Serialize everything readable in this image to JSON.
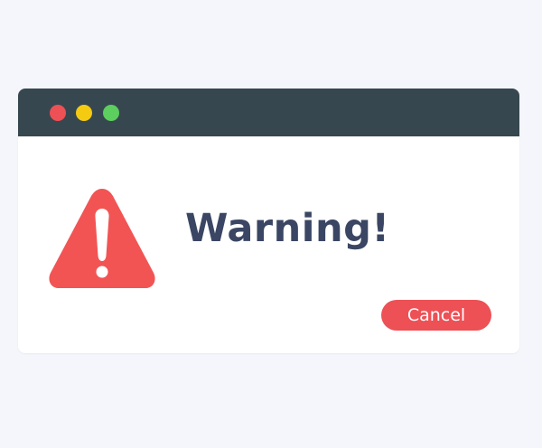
{
  "dialog": {
    "title": "Warning!",
    "cancel_label": "Cancel",
    "icon": "warning-triangle-icon"
  },
  "window_controls": {
    "close_color": "#ed5055",
    "minimize_color": "#f5cb12",
    "maximize_color": "#5ccf5f"
  },
  "colors": {
    "titlebar": "#37474f",
    "accent": "#ed5055",
    "title_text": "#3a4663",
    "background": "#f5f6fb"
  }
}
